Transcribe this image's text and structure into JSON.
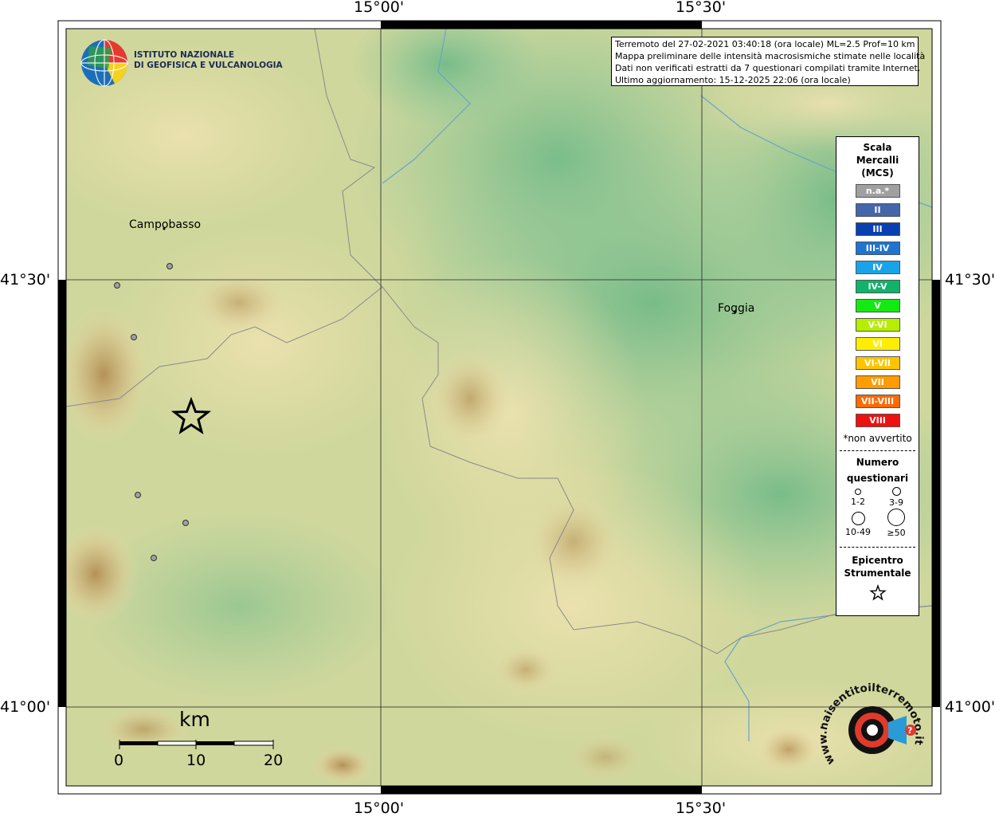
{
  "info": {
    "line1": "Terremoto del 27-02-2021 03:40:18 (ora locale) ML=2.5 Prof=10 km",
    "line2": "Mappa preliminare delle intensità macrosismiche stimate nelle località",
    "line3": "Dati non verificati estratti da 7 questionari compilati tramite Internet.",
    "line4": "Ultimo aggiornamento: 15-12-2025 22:06 (ora locale)"
  },
  "logo": {
    "line1": "ISTITUTO NAZIONALE",
    "line2": "DI GEOFISICA E VULCANOLOGIA"
  },
  "axes": {
    "top": [
      "15°00'",
      "15°30'"
    ],
    "bottom": [
      "15°00'",
      "15°30'"
    ],
    "left": [
      "41°30'",
      "41°00'"
    ],
    "right": [
      "41°30'",
      "41°00'"
    ]
  },
  "cities": [
    {
      "name": "Campobasso"
    },
    {
      "name": "Foggia"
    }
  ],
  "legend": {
    "title1": "Scala",
    "title2": "Mercalli",
    "title3": "(MCS)",
    "classes": [
      {
        "label": "n.a.*",
        "color": "#a0a0a0"
      },
      {
        "label": "II",
        "color": "#4466aa"
      },
      {
        "label": "III",
        "color": "#0a3fb0"
      },
      {
        "label": "III-IV",
        "color": "#1e74d0"
      },
      {
        "label": "IV",
        "color": "#1aa3e8"
      },
      {
        "label": "IV-V",
        "color": "#11b36a"
      },
      {
        "label": "V",
        "color": "#12ea12"
      },
      {
        "label": "V-VI",
        "color": "#b6ee00"
      },
      {
        "label": "VI",
        "color": "#ffee00"
      },
      {
        "label": "VI-VII",
        "color": "#ffc400"
      },
      {
        "label": "VII",
        "color": "#ff9c00"
      },
      {
        "label": "VII-VIII",
        "color": "#ff6a00"
      },
      {
        "label": "VIII",
        "color": "#ee1111"
      }
    ],
    "note": "*non avvertito",
    "questionari_title1": "Numero",
    "questionari_title2": "questionari",
    "sizes": [
      "1-2",
      "3-9",
      "10-49",
      "≥50"
    ],
    "epicentro1": "Epicentro",
    "epicentro2": "Strumentale"
  },
  "scale_bar": {
    "unit": "km",
    "ticks": [
      "0",
      "10",
      "20"
    ]
  },
  "watermark": {
    "text": "www.haisentitoilterremoto.it"
  },
  "colors": {
    "relief_low": "#7fbf8a",
    "relief_mid": "#e2dca4",
    "relief_high": "#b58a4c",
    "observation_dot": "#a0a0a0"
  }
}
